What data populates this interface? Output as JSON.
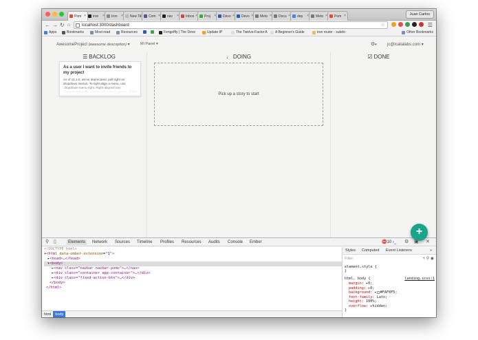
{
  "browser": {
    "user_chip": "Juan Carlos",
    "tabs": [
      {
        "label": "Pom",
        "color": "#e24b2d",
        "active": true
      },
      {
        "label": "iron",
        "color": "#222222"
      },
      {
        "label": "Iron",
        "color": "#888888"
      },
      {
        "label": "New Ta",
        "color": "#bbbbbb"
      },
      {
        "label": "Com",
        "color": "#5a4ea3"
      },
      {
        "label": "nav",
        "color": "#222222"
      },
      {
        "label": "Inbox",
        "color": "#d44638"
      },
      {
        "label": "Proj",
        "color": "#39a845"
      },
      {
        "label": "Devo",
        "color": "#2a5db0"
      },
      {
        "label": "Devo",
        "color": "#2a5db0"
      },
      {
        "label": "Meto",
        "color": "#777777"
      },
      {
        "label": "Docu",
        "color": "#777777"
      },
      {
        "label": "dep",
        "color": "#4285f4"
      },
      {
        "label": "Meto",
        "color": "#777777"
      },
      {
        "label": "Pom",
        "color": "#e24b2d"
      }
    ],
    "url": "localhost:3000/dashboard",
    "bookmarks": [
      {
        "label": "Apps",
        "color": "#4a7bd8"
      },
      {
        "label": "Bookmarks",
        "color": "#555555"
      },
      {
        "label": "Most read",
        "color": "#7a8fa8"
      },
      {
        "label": "Resources",
        "color": "#7a8fa8"
      },
      {
        "label": "",
        "color": "#3b5998"
      },
      {
        "label": "",
        "color": "#34a853"
      },
      {
        "label": "Fengoffly | The Deve",
        "color": "#222222"
      },
      {
        "label": "Update IP",
        "color": "#f0a030"
      },
      {
        "label": "The Twelve-Factor A",
        "color": "#dddddd"
      },
      {
        "label": "A Beginner's Guide",
        "color": "#dddddd"
      },
      {
        "label": "iron router - subdo",
        "color": "#e0c070"
      }
    ],
    "other_bookmarks": "Other Bookmarks"
  },
  "app": {
    "brand": "AwesomeProject",
    "brand_desc": "(awesome description)",
    "panel_menu": "Mi Panel",
    "user_menu": "jc@icalialabs.com",
    "columns": {
      "backlog": "BACKLOG",
      "doing": "DOING",
      "done": "DONE"
    },
    "card": {
      "title": "As a user I want to invite friends to my project",
      "body": "As of v3.1.0, we've deprecated .pull-right on dropdown menus. To right-align a menu, use .dropdown-menu-right. Right-aligned nav components in the navbar use a mixin version of this class to automatically align the menu."
    },
    "dropzone_text": "Pick up a story to start",
    "fab_label": "+"
  },
  "devtools": {
    "tabs": [
      "Elements",
      "Network",
      "Sources",
      "Timeline",
      "Profiles",
      "Resources",
      "Audits",
      "Console",
      "Ember"
    ],
    "error_count": "10",
    "dom": {
      "doctype": "<!DOCTYPE html>",
      "html_open": "html",
      "html_attr": "data-ember-extension",
      "html_attr_val": "\"1\"",
      "head": "<head>…</head>",
      "body": "<body>",
      "nav": "<nav class=\"navbar navbar-pomo\">…</nav>",
      "div1": "<div class=\"container app-container\">…</div>",
      "div2": "<div class=\"fixed-action-btn\">…</div>",
      "body_close": "</body>",
      "html_close": "</html>"
    },
    "breadcrumbs": [
      "html",
      "body"
    ],
    "styles_tabs": [
      "Styles",
      "Computed",
      "Event Listeners"
    ],
    "filter_placeholder": "Filter",
    "element_style": "element.style {",
    "close_brace": "}",
    "rule_selector": "html, body {",
    "rule_source": "landing.scss:1",
    "rule_props": [
      {
        "name": "margin",
        "value": "0;"
      },
      {
        "name": "padding",
        "value": "0;"
      },
      {
        "name": "background",
        "value": "#FAF8F5;"
      },
      {
        "name": "font-family",
        "value": "Lato;"
      },
      {
        "name": "height",
        "value": "100%;"
      },
      {
        "name": "overflow",
        "value": "hidden;"
      }
    ]
  }
}
